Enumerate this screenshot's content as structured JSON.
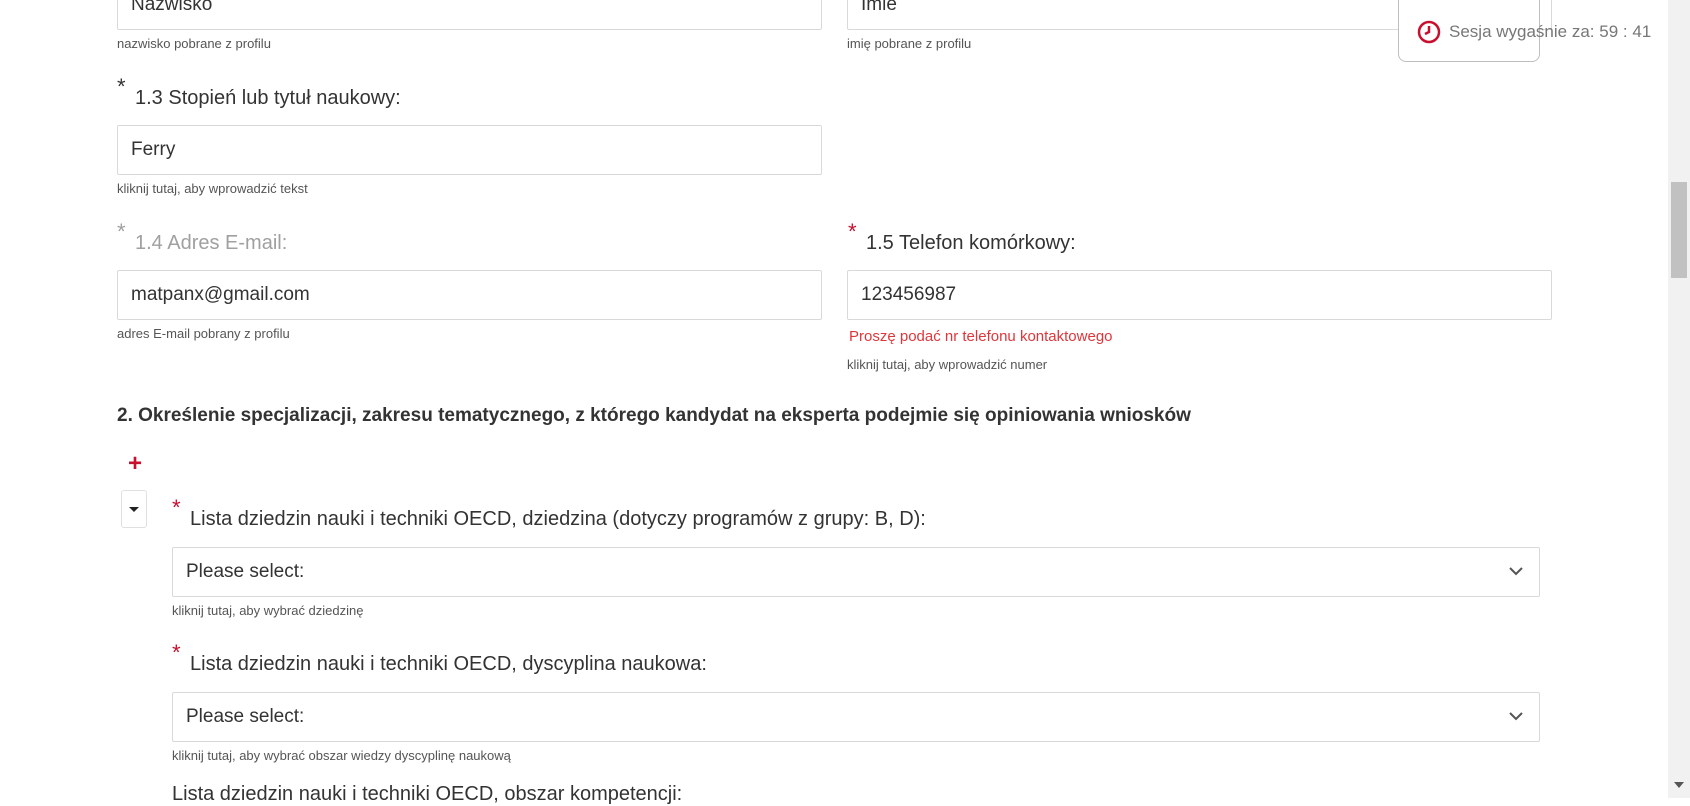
{
  "personal": {
    "surname_value": "Nazwisko",
    "surname_hint": "nazwisko pobrane z profilu",
    "firstname_value": "Imie",
    "firstname_hint": "imię pobrane z profilu",
    "degree_star": "*",
    "degree_label": "1.3 Stopień lub tytuł naukowy:",
    "degree_value": "Ferry",
    "degree_hint": "kliknij tutaj, aby wprowadzić tekst",
    "email_star": "*",
    "email_label": "1.4 Adres E-mail:",
    "email_value": "matpanx@gmail.com",
    "email_hint": "adres E-mail pobrany z profilu",
    "phone_star": "*",
    "phone_label": "1.5 Telefon komórkowy:",
    "phone_value": "123456987",
    "phone_error": "Proszę podać nr telefonu kontaktowego",
    "phone_hint": "kliknij tutaj, aby wprowadzić numer"
  },
  "section2": {
    "title": "2. Określenie specjalizacji, zakresu tematycznego, z którego kandydat na eksperta podejmie się opiniowania wniosków",
    "add_symbol": "+",
    "field_star": "*",
    "field_label": "Lista dziedzin nauki i techniki OECD, dziedzina (dotyczy programów z grupy: B, D):",
    "field_value": "Please select:",
    "field_hint": "kliknij tutaj, aby wybrać dziedzinę",
    "discipline_star": "*",
    "discipline_label": "Lista dziedzin nauki i techniki OECD, dyscyplina naukowa:",
    "discipline_value": "Please select:",
    "discipline_hint": "kliknij tutaj, aby wybrać obszar wiedzy dyscyplinę naukową",
    "competence_label": "Lista dziedzin nauki i techniki OECD, obszar kompetencji:"
  },
  "session": {
    "text": "Sesja wygaśnie za: 59 : 41"
  },
  "icons": {
    "clock": "clock-icon",
    "chevron": "chevron-down-icon",
    "caret": "caret-down-icon"
  },
  "colors": {
    "accent_red": "#c8102e",
    "error_red": "#e0363b"
  }
}
